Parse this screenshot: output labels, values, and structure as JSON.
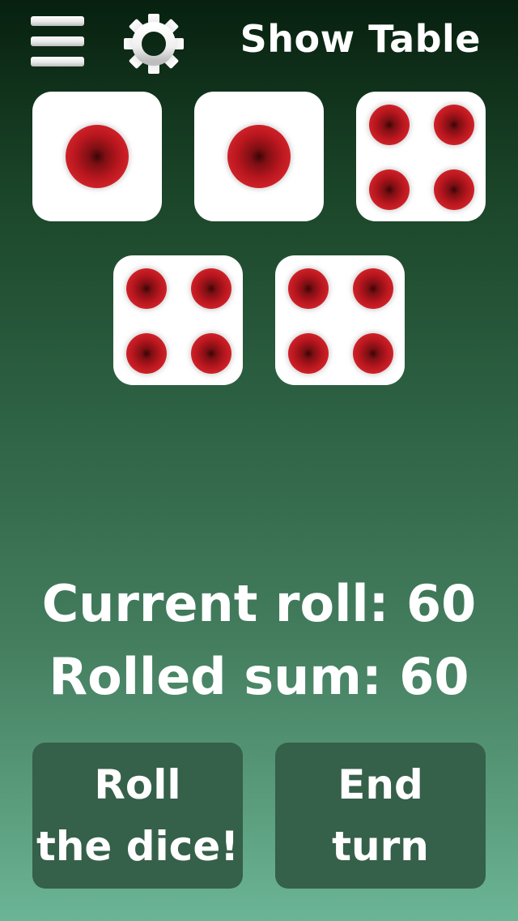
{
  "toolbar": {
    "menu_icon": "hamburger-menu-icon",
    "settings_icon": "gear-icon",
    "show_table_label": "Show Table"
  },
  "dice": [
    {
      "value": 1
    },
    {
      "value": 1
    },
    {
      "value": 4
    },
    {
      "value": 4
    },
    {
      "value": 4
    }
  ],
  "stats": {
    "current_roll": "Current roll: 60",
    "rolled_sum": "Rolled sum: 60"
  },
  "buttons": {
    "roll": {
      "line1": "Roll",
      "line2": "the dice!"
    },
    "end_turn": {
      "line1": "End",
      "line2": "turn"
    }
  },
  "colors": {
    "pip_red": "#c8161f",
    "die_face": "#ffffff",
    "button_bg": "#356049"
  }
}
